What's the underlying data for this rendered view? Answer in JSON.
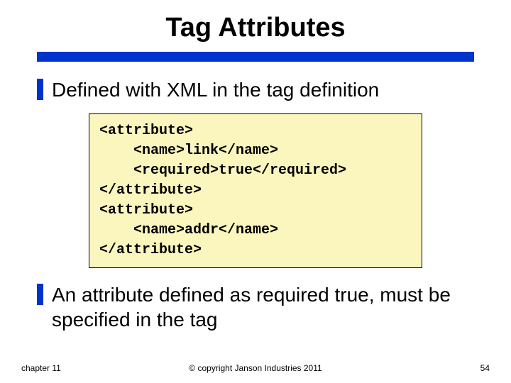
{
  "title": "Tag Attributes",
  "bullets": {
    "first": "Defined with XML in the tag definition",
    "second": "An attribute defined as required true, must be specified in the tag"
  },
  "code": "<attribute>\n    <name>link</name>\n    <required>true</required>\n</attribute>\n<attribute>\n    <name>addr</name>\n</attribute>",
  "footer": {
    "left": "chapter 11",
    "center": "© copyright Janson Industries 2011",
    "right": "54"
  }
}
